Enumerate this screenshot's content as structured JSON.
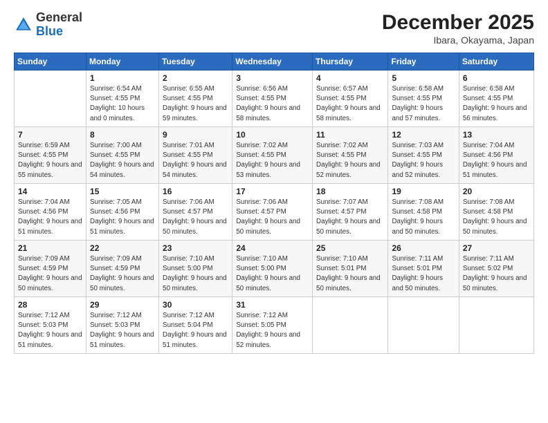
{
  "header": {
    "logo_line1": "General",
    "logo_line2": "Blue",
    "month": "December 2025",
    "location": "Ibara, Okayama, Japan"
  },
  "days_of_week": [
    "Sunday",
    "Monday",
    "Tuesday",
    "Wednesday",
    "Thursday",
    "Friday",
    "Saturday"
  ],
  "weeks": [
    [
      {
        "day": "",
        "sunrise": "",
        "sunset": "",
        "daylight": ""
      },
      {
        "day": "1",
        "sunrise": "Sunrise: 6:54 AM",
        "sunset": "Sunset: 4:55 PM",
        "daylight": "Daylight: 10 hours and 0 minutes."
      },
      {
        "day": "2",
        "sunrise": "Sunrise: 6:55 AM",
        "sunset": "Sunset: 4:55 PM",
        "daylight": "Daylight: 9 hours and 59 minutes."
      },
      {
        "day": "3",
        "sunrise": "Sunrise: 6:56 AM",
        "sunset": "Sunset: 4:55 PM",
        "daylight": "Daylight: 9 hours and 58 minutes."
      },
      {
        "day": "4",
        "sunrise": "Sunrise: 6:57 AM",
        "sunset": "Sunset: 4:55 PM",
        "daylight": "Daylight: 9 hours and 58 minutes."
      },
      {
        "day": "5",
        "sunrise": "Sunrise: 6:58 AM",
        "sunset": "Sunset: 4:55 PM",
        "daylight": "Daylight: 9 hours and 57 minutes."
      },
      {
        "day": "6",
        "sunrise": "Sunrise: 6:58 AM",
        "sunset": "Sunset: 4:55 PM",
        "daylight": "Daylight: 9 hours and 56 minutes."
      }
    ],
    [
      {
        "day": "7",
        "sunrise": "Sunrise: 6:59 AM",
        "sunset": "Sunset: 4:55 PM",
        "daylight": "Daylight: 9 hours and 55 minutes."
      },
      {
        "day": "8",
        "sunrise": "Sunrise: 7:00 AM",
        "sunset": "Sunset: 4:55 PM",
        "daylight": "Daylight: 9 hours and 54 minutes."
      },
      {
        "day": "9",
        "sunrise": "Sunrise: 7:01 AM",
        "sunset": "Sunset: 4:55 PM",
        "daylight": "Daylight: 9 hours and 54 minutes."
      },
      {
        "day": "10",
        "sunrise": "Sunrise: 7:02 AM",
        "sunset": "Sunset: 4:55 PM",
        "daylight": "Daylight: 9 hours and 53 minutes."
      },
      {
        "day": "11",
        "sunrise": "Sunrise: 7:02 AM",
        "sunset": "Sunset: 4:55 PM",
        "daylight": "Daylight: 9 hours and 52 minutes."
      },
      {
        "day": "12",
        "sunrise": "Sunrise: 7:03 AM",
        "sunset": "Sunset: 4:55 PM",
        "daylight": "Daylight: 9 hours and 52 minutes."
      },
      {
        "day": "13",
        "sunrise": "Sunrise: 7:04 AM",
        "sunset": "Sunset: 4:56 PM",
        "daylight": "Daylight: 9 hours and 51 minutes."
      }
    ],
    [
      {
        "day": "14",
        "sunrise": "Sunrise: 7:04 AM",
        "sunset": "Sunset: 4:56 PM",
        "daylight": "Daylight: 9 hours and 51 minutes."
      },
      {
        "day": "15",
        "sunrise": "Sunrise: 7:05 AM",
        "sunset": "Sunset: 4:56 PM",
        "daylight": "Daylight: 9 hours and 51 minutes."
      },
      {
        "day": "16",
        "sunrise": "Sunrise: 7:06 AM",
        "sunset": "Sunset: 4:57 PM",
        "daylight": "Daylight: 9 hours and 50 minutes."
      },
      {
        "day": "17",
        "sunrise": "Sunrise: 7:06 AM",
        "sunset": "Sunset: 4:57 PM",
        "daylight": "Daylight: 9 hours and 50 minutes."
      },
      {
        "day": "18",
        "sunrise": "Sunrise: 7:07 AM",
        "sunset": "Sunset: 4:57 PM",
        "daylight": "Daylight: 9 hours and 50 minutes."
      },
      {
        "day": "19",
        "sunrise": "Sunrise: 7:08 AM",
        "sunset": "Sunset: 4:58 PM",
        "daylight": "Daylight: 9 hours and 50 minutes."
      },
      {
        "day": "20",
        "sunrise": "Sunrise: 7:08 AM",
        "sunset": "Sunset: 4:58 PM",
        "daylight": "Daylight: 9 hours and 50 minutes."
      }
    ],
    [
      {
        "day": "21",
        "sunrise": "Sunrise: 7:09 AM",
        "sunset": "Sunset: 4:59 PM",
        "daylight": "Daylight: 9 hours and 50 minutes."
      },
      {
        "day": "22",
        "sunrise": "Sunrise: 7:09 AM",
        "sunset": "Sunset: 4:59 PM",
        "daylight": "Daylight: 9 hours and 50 minutes."
      },
      {
        "day": "23",
        "sunrise": "Sunrise: 7:10 AM",
        "sunset": "Sunset: 5:00 PM",
        "daylight": "Daylight: 9 hours and 50 minutes."
      },
      {
        "day": "24",
        "sunrise": "Sunrise: 7:10 AM",
        "sunset": "Sunset: 5:00 PM",
        "daylight": "Daylight: 9 hours and 50 minutes."
      },
      {
        "day": "25",
        "sunrise": "Sunrise: 7:10 AM",
        "sunset": "Sunset: 5:01 PM",
        "daylight": "Daylight: 9 hours and 50 minutes."
      },
      {
        "day": "26",
        "sunrise": "Sunrise: 7:11 AM",
        "sunset": "Sunset: 5:01 PM",
        "daylight": "Daylight: 9 hours and 50 minutes."
      },
      {
        "day": "27",
        "sunrise": "Sunrise: 7:11 AM",
        "sunset": "Sunset: 5:02 PM",
        "daylight": "Daylight: 9 hours and 50 minutes."
      }
    ],
    [
      {
        "day": "28",
        "sunrise": "Sunrise: 7:12 AM",
        "sunset": "Sunset: 5:03 PM",
        "daylight": "Daylight: 9 hours and 51 minutes."
      },
      {
        "day": "29",
        "sunrise": "Sunrise: 7:12 AM",
        "sunset": "Sunset: 5:03 PM",
        "daylight": "Daylight: 9 hours and 51 minutes."
      },
      {
        "day": "30",
        "sunrise": "Sunrise: 7:12 AM",
        "sunset": "Sunset: 5:04 PM",
        "daylight": "Daylight: 9 hours and 51 minutes."
      },
      {
        "day": "31",
        "sunrise": "Sunrise: 7:12 AM",
        "sunset": "Sunset: 5:05 PM",
        "daylight": "Daylight: 9 hours and 52 minutes."
      },
      {
        "day": "",
        "sunrise": "",
        "sunset": "",
        "daylight": ""
      },
      {
        "day": "",
        "sunrise": "",
        "sunset": "",
        "daylight": ""
      },
      {
        "day": "",
        "sunrise": "",
        "sunset": "",
        "daylight": ""
      }
    ]
  ]
}
